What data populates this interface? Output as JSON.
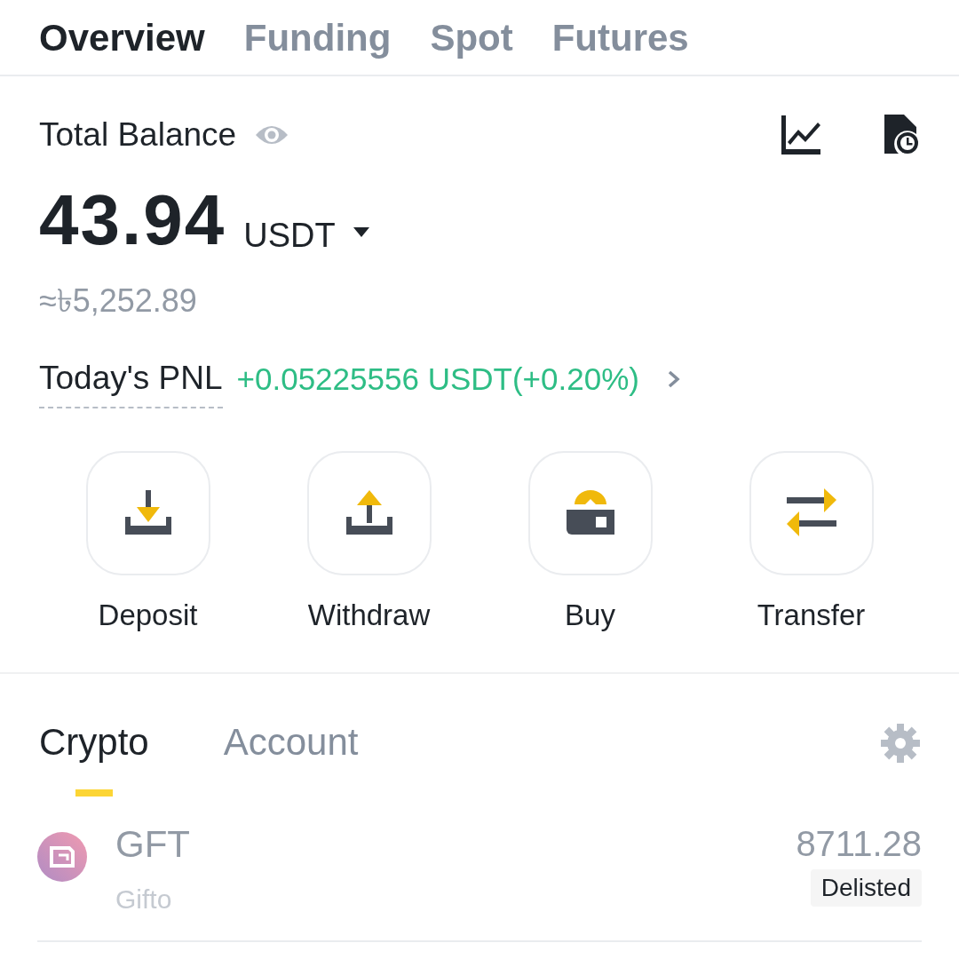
{
  "top_tabs": [
    {
      "label": "Overview",
      "selected": true
    },
    {
      "label": "Funding",
      "selected": false
    },
    {
      "label": "Spot",
      "selected": false
    },
    {
      "label": "Futures",
      "selected": false
    }
  ],
  "balance": {
    "label": "Total Balance",
    "amount": "43.94",
    "currency": "USDT",
    "fiat": "≈৳5,252.89",
    "pnl_label": "Today's PNL",
    "pnl_value": "+0.05225556 USDT(+0.20%)"
  },
  "actions": [
    {
      "kind": "deposit",
      "label": "Deposit"
    },
    {
      "kind": "withdraw",
      "label": "Withdraw"
    },
    {
      "kind": "buy",
      "label": "Buy"
    },
    {
      "kind": "transfer",
      "label": "Transfer"
    }
  ],
  "asset_tabs": [
    {
      "label": "Crypto",
      "selected": true
    },
    {
      "label": "Account",
      "selected": false
    }
  ],
  "assets": [
    {
      "symbol": "GFT",
      "name": "Gifto",
      "amount": "8711.28",
      "status": "Delisted"
    }
  ]
}
